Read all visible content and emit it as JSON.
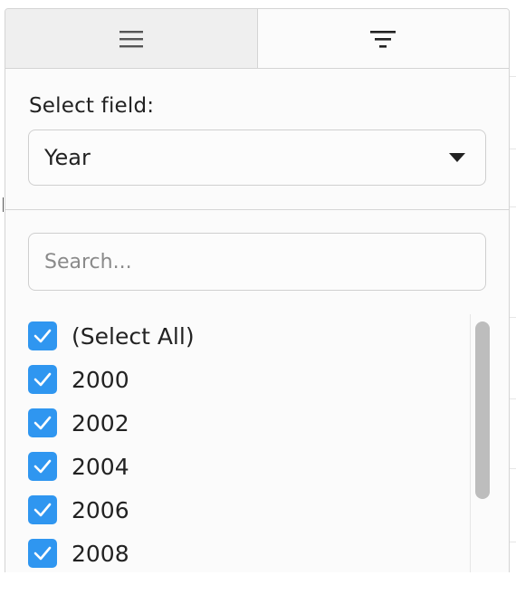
{
  "tabs": [
    {
      "icon": "hamburger-menu-icon",
      "active": false
    },
    {
      "icon": "filter-icon",
      "active": true
    }
  ],
  "field": {
    "label": "Select field:",
    "selected": "Year"
  },
  "search": {
    "placeholder": "Search..."
  },
  "values": [
    {
      "label": "(Select All)",
      "checked": true
    },
    {
      "label": "2000",
      "checked": true
    },
    {
      "label": "2002",
      "checked": true
    },
    {
      "label": "2004",
      "checked": true
    },
    {
      "label": "2006",
      "checked": true
    },
    {
      "label": "2008",
      "checked": true
    }
  ],
  "colors": {
    "checkbox": "#2f96f0"
  }
}
